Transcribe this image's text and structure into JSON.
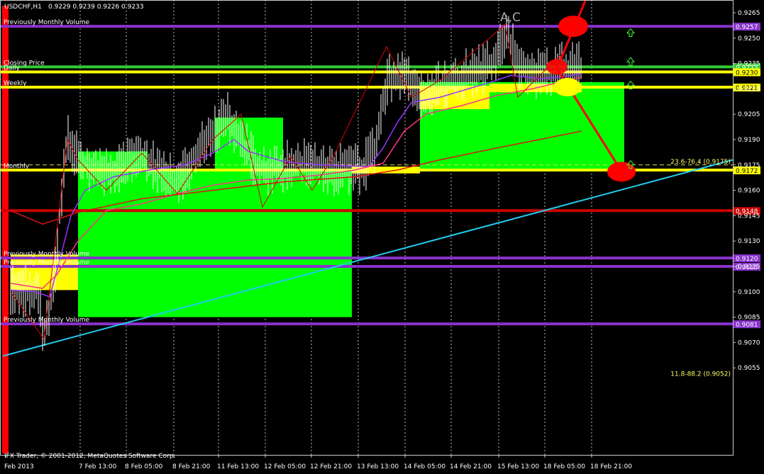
{
  "header": {
    "symbol_tf": "USDCHF,H1",
    "ohlc": "0.9229 0.9239 0.9226 0.9233"
  },
  "footer": {
    "copyright": "IFX Trader, © 2001-2012, MetaQuotes Software Corp."
  },
  "chart_data": {
    "type": "candlestick",
    "symbol": "USDCHF",
    "timeframe": "H1",
    "ylim": [
      0.905,
      0.9272
    ],
    "y_ticks": [
      "0.9265",
      "0.9250",
      "0.9235",
      "0.9220",
      "0.9205",
      "0.9190",
      "0.9175",
      "0.9160",
      "0.9145",
      "0.9130",
      "0.9115",
      "0.9100",
      "0.9085",
      "0.9070",
      "0.9055"
    ],
    "x_ticks": [
      "6 Feb 2013",
      "7 Feb 13:00",
      "8 Feb 05:00",
      "8 Feb 21:00",
      "11 Feb 13:00",
      "12 Feb 05:00",
      "12 Feb 21:00",
      "13 Feb 13:00",
      "14 Feb 05:00",
      "14 Feb 21:00",
      "15 Feb 13:00",
      "18 Feb 05:00",
      "18 Feb 21:00"
    ],
    "x_tick_display": [
      "Feb 2013",
      "7 Feb 13:00",
      "8 Feb 05:00",
      "8 Feb 21:00",
      "11 Feb 13:00",
      "12 Feb 05:00",
      "12 Feb 21:00",
      "13 Feb 13:00",
      "14 Feb 05:00",
      "14 Feb 21:00",
      "15 Feb 13:00",
      "18 Feb 05:00",
      "18 Feb 21:00"
    ],
    "horizontal_levels": [
      {
        "label": "Previously Monthly Volume",
        "price": 0.9257,
        "tag": "0.9257",
        "color": "#8833cc"
      },
      {
        "label": "Closing Price",
        "price": 0.9233,
        "tag": "0.9233",
        "color": "#33cc33"
      },
      {
        "label": "Daily",
        "price": 0.923,
        "tag": "0.9230",
        "color": "#ffff00"
      },
      {
        "label": "Weekly",
        "price": 0.9221,
        "tag": "0.9221",
        "color": "#ffff00"
      },
      {
        "label": "Monthly",
        "price": 0.9172,
        "tag": "0.9172",
        "color": "#ffff00"
      },
      {
        "label": "",
        "price": 0.9148,
        "tag": "0.9148",
        "color": "#cc0000"
      },
      {
        "label": "Previously Monthly Volume",
        "price": 0.912,
        "tag": "0.9120",
        "color": "#8833cc"
      },
      {
        "label": "Previously Monthly Volume",
        "price": 0.9115,
        "tag": "0.9115",
        "color": "#8833cc"
      },
      {
        "label": "Previously Monthly Volume",
        "price": 0.9081,
        "tag": "0.9081",
        "color": "#8833cc"
      }
    ],
    "fib_labels": [
      {
        "text": "23.6-76.4 (0.9175)",
        "price": 0.9175
      },
      {
        "text": "11.8-88.2 (0.9052)",
        "price": 0.9052
      }
    ],
    "annotations": [
      {
        "text": "A,C",
        "color": "#aaaaaa"
      }
    ],
    "colors": {
      "background": "#000000",
      "candles": "#ffffff",
      "box_fill": "#00ff00",
      "box_highlight": "#ffff00",
      "trendline": "#22ccee",
      "zigzag": "#dd0000",
      "ma_fast": "#9933ff",
      "ma_mid": "#ff3388",
      "ma_slow": "#dd1111",
      "forecast": "#ff0000",
      "side_bar": "#ff0000",
      "arrow": "#33ff33"
    }
  }
}
